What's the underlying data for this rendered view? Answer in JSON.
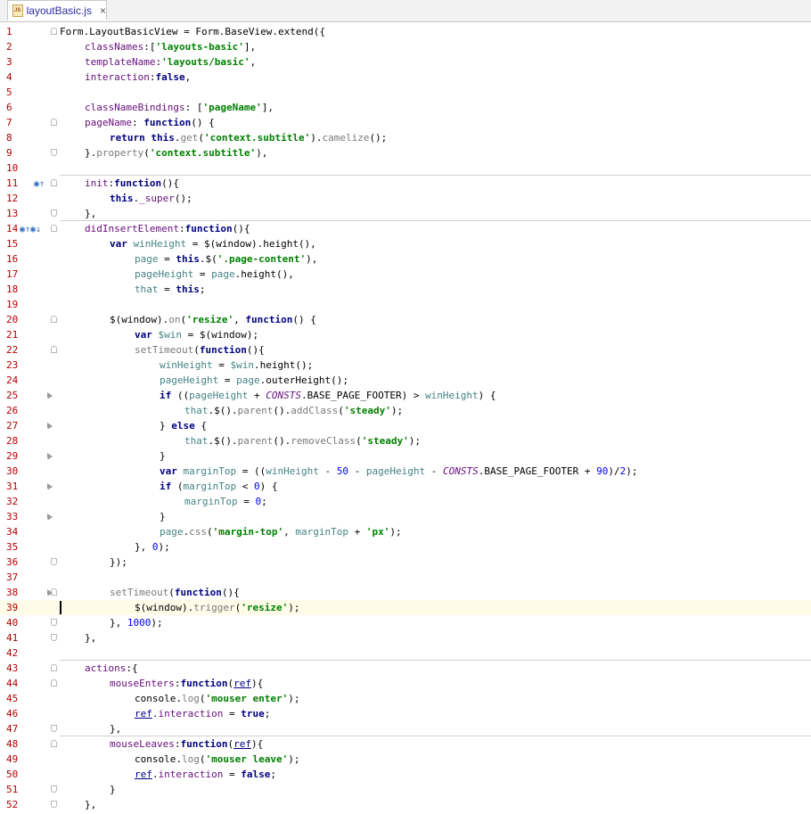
{
  "tab": {
    "title": "layoutBasic.js",
    "icon": "js-file-icon",
    "close": "×"
  },
  "lines": [
    {
      "n": "1",
      "indent": 0,
      "t": [
        [
          "pl",
          "Form.LayoutBasicView = Form.BaseView.extend({"
        ]
      ]
    },
    {
      "n": "2",
      "indent": 4,
      "t": [
        [
          "prop",
          "classNames"
        ],
        [
          "pl",
          ":["
        ],
        [
          "str",
          "'layouts-basic'"
        ],
        [
          "pl",
          "],"
        ]
      ]
    },
    {
      "n": "3",
      "indent": 4,
      "t": [
        [
          "prop",
          "templateName"
        ],
        [
          "pl",
          ":"
        ],
        [
          "str",
          "'layouts/basic'"
        ],
        [
          "pl",
          ","
        ]
      ]
    },
    {
      "n": "4",
      "indent": 4,
      "t": [
        [
          "prop",
          "interaction"
        ],
        [
          "pl",
          ":"
        ],
        [
          "kw",
          "false"
        ],
        [
          "pl",
          ","
        ]
      ]
    },
    {
      "n": "5",
      "indent": 0,
      "t": []
    },
    {
      "n": "6",
      "indent": 4,
      "t": [
        [
          "prop",
          "classNameBindings"
        ],
        [
          "pl",
          ": ["
        ],
        [
          "str",
          "'pageName'"
        ],
        [
          "pl",
          "],"
        ]
      ]
    },
    {
      "n": "7",
      "indent": 4,
      "t": [
        [
          "prop",
          "pageName"
        ],
        [
          "pl",
          ": "
        ],
        [
          "kw",
          "function"
        ],
        [
          "pl",
          "() {"
        ]
      ]
    },
    {
      "n": "8",
      "indent": 8,
      "t": [
        [
          "kw",
          "return this"
        ],
        [
          "pl",
          "."
        ],
        [
          "fn",
          "get"
        ],
        [
          "pl",
          "("
        ],
        [
          "str",
          "'context.subtitle'"
        ],
        [
          "pl",
          ")."
        ],
        [
          "fn",
          "camelize"
        ],
        [
          "pl",
          "();"
        ]
      ]
    },
    {
      "n": "9",
      "indent": 4,
      "t": [
        [
          "pl",
          "}."
        ],
        [
          "fn",
          "property"
        ],
        [
          "pl",
          "("
        ],
        [
          "str",
          "'context.subtitle'"
        ],
        [
          "pl",
          "),"
        ]
      ]
    },
    {
      "n": "10",
      "indent": 0,
      "t": []
    },
    {
      "n": "11",
      "indent": 4,
      "t": [
        [
          "prop",
          "init"
        ],
        [
          "pl",
          ":"
        ],
        [
          "kw",
          "function"
        ],
        [
          "pl",
          "(){"
        ]
      ]
    },
    {
      "n": "12",
      "indent": 8,
      "t": [
        [
          "kw",
          "this"
        ],
        [
          "pl",
          "."
        ],
        [
          "prop",
          "_super"
        ],
        [
          "pl",
          "();"
        ]
      ]
    },
    {
      "n": "13",
      "indent": 4,
      "t": [
        [
          "pl",
          "},"
        ]
      ]
    },
    {
      "n": "14",
      "indent": 4,
      "t": [
        [
          "prop",
          "didInsertElement"
        ],
        [
          "pl",
          ":"
        ],
        [
          "kw",
          "function"
        ],
        [
          "pl",
          "(){"
        ]
      ]
    },
    {
      "n": "15",
      "indent": 8,
      "t": [
        [
          "kw",
          "var "
        ],
        [
          "var",
          "winHeight"
        ],
        [
          "pl",
          " = $(window)."
        ],
        [
          "pl",
          "height(),"
        ]
      ]
    },
    {
      "n": "16",
      "indent": 12,
      "t": [
        [
          "var",
          "page"
        ],
        [
          "pl",
          " = "
        ],
        [
          "kw",
          "this"
        ],
        [
          "pl",
          ".$("
        ],
        [
          "str",
          "'.page-content'"
        ],
        [
          "pl",
          "),"
        ]
      ]
    },
    {
      "n": "17",
      "indent": 12,
      "t": [
        [
          "var",
          "pageHeight"
        ],
        [
          "pl",
          " = "
        ],
        [
          "var",
          "page"
        ],
        [
          "pl",
          ".height(),"
        ]
      ]
    },
    {
      "n": "18",
      "indent": 12,
      "t": [
        [
          "var",
          "that"
        ],
        [
          "pl",
          " = "
        ],
        [
          "kw",
          "this"
        ],
        [
          "pl",
          ";"
        ]
      ]
    },
    {
      "n": "19",
      "indent": 0,
      "t": []
    },
    {
      "n": "20",
      "indent": 8,
      "t": [
        [
          "pl",
          "$(window)."
        ],
        [
          "fn",
          "on"
        ],
        [
          "pl",
          "("
        ],
        [
          "str",
          "'resize'"
        ],
        [
          "pl",
          ", "
        ],
        [
          "kw",
          "function"
        ],
        [
          "pl",
          "() {"
        ]
      ]
    },
    {
      "n": "21",
      "indent": 12,
      "t": [
        [
          "kw",
          "var "
        ],
        [
          "var",
          "$win"
        ],
        [
          "pl",
          " = $(window);"
        ]
      ]
    },
    {
      "n": "22",
      "indent": 12,
      "t": [
        [
          "fn",
          "setTimeout"
        ],
        [
          "pl",
          "("
        ],
        [
          "kw",
          "function"
        ],
        [
          "pl",
          "(){"
        ]
      ]
    },
    {
      "n": "23",
      "indent": 16,
      "t": [
        [
          "var",
          "winHeight"
        ],
        [
          "pl",
          " = "
        ],
        [
          "var",
          "$win"
        ],
        [
          "pl",
          ".height();"
        ]
      ]
    },
    {
      "n": "24",
      "indent": 16,
      "t": [
        [
          "var",
          "pageHeight"
        ],
        [
          "pl",
          " = "
        ],
        [
          "var",
          "page"
        ],
        [
          "pl",
          ".outerHeight();"
        ]
      ]
    },
    {
      "n": "25",
      "indent": 16,
      "t": [
        [
          "kw",
          "if"
        ],
        [
          "pl",
          " (("
        ],
        [
          "var",
          "pageHeight"
        ],
        [
          "pl",
          " + "
        ],
        [
          "con",
          "CONSTS"
        ],
        [
          "pl",
          ".BASE_PAGE_FOOTER) > "
        ],
        [
          "var",
          "winHeight"
        ],
        [
          "pl",
          ") {"
        ]
      ]
    },
    {
      "n": "26",
      "indent": 20,
      "t": [
        [
          "var",
          "that"
        ],
        [
          "pl",
          ".$()."
        ],
        [
          "fn",
          "parent"
        ],
        [
          "pl",
          "()."
        ],
        [
          "fn",
          "addClass"
        ],
        [
          "pl",
          "("
        ],
        [
          "str",
          "'steady'"
        ],
        [
          "pl",
          ");"
        ]
      ]
    },
    {
      "n": "27",
      "indent": 16,
      "t": [
        [
          "pl",
          "} "
        ],
        [
          "kw",
          "else"
        ],
        [
          "pl",
          " {"
        ]
      ]
    },
    {
      "n": "28",
      "indent": 20,
      "t": [
        [
          "var",
          "that"
        ],
        [
          "pl",
          ".$()."
        ],
        [
          "fn",
          "parent"
        ],
        [
          "pl",
          "()."
        ],
        [
          "fn",
          "removeClass"
        ],
        [
          "pl",
          "("
        ],
        [
          "str",
          "'steady'"
        ],
        [
          "pl",
          ");"
        ]
      ]
    },
    {
      "n": "29",
      "indent": 16,
      "t": [
        [
          "pl",
          "}"
        ]
      ]
    },
    {
      "n": "30",
      "indent": 16,
      "t": [
        [
          "kw",
          "var "
        ],
        [
          "var",
          "marginTop"
        ],
        [
          "pl",
          " = (("
        ],
        [
          "var",
          "winHeight"
        ],
        [
          "pl",
          " - "
        ],
        [
          "num",
          "50"
        ],
        [
          "pl",
          " - "
        ],
        [
          "var",
          "pageHeight"
        ],
        [
          "pl",
          " - "
        ],
        [
          "con",
          "CONSTS"
        ],
        [
          "pl",
          ".BASE_PAGE_FOOTER + "
        ],
        [
          "num",
          "90"
        ],
        [
          "pl",
          ")/"
        ],
        [
          "num",
          "2"
        ],
        [
          "pl",
          ");"
        ]
      ]
    },
    {
      "n": "31",
      "indent": 16,
      "t": [
        [
          "kw",
          "if"
        ],
        [
          "pl",
          " ("
        ],
        [
          "var",
          "marginTop"
        ],
        [
          "pl",
          " < "
        ],
        [
          "num",
          "0"
        ],
        [
          "pl",
          ") {"
        ]
      ]
    },
    {
      "n": "32",
      "indent": 20,
      "t": [
        [
          "var",
          "marginTop"
        ],
        [
          "pl",
          " = "
        ],
        [
          "num",
          "0"
        ],
        [
          "pl",
          ";"
        ]
      ]
    },
    {
      "n": "33",
      "indent": 16,
      "t": [
        [
          "pl",
          "}"
        ]
      ]
    },
    {
      "n": "34",
      "indent": 16,
      "t": [
        [
          "var",
          "page"
        ],
        [
          "pl",
          "."
        ],
        [
          "fn",
          "css"
        ],
        [
          "pl",
          "("
        ],
        [
          "str",
          "'margin-top'"
        ],
        [
          "pl",
          ", "
        ],
        [
          "var",
          "marginTop"
        ],
        [
          "pl",
          " + "
        ],
        [
          "str",
          "'px'"
        ],
        [
          "pl",
          ");"
        ]
      ]
    },
    {
      "n": "35",
      "indent": 12,
      "t": [
        [
          "pl",
          "}, "
        ],
        [
          "num",
          "0"
        ],
        [
          "pl",
          ");"
        ]
      ]
    },
    {
      "n": "36",
      "indent": 8,
      "t": [
        [
          "pl",
          "});"
        ]
      ]
    },
    {
      "n": "37",
      "indent": 0,
      "t": []
    },
    {
      "n": "38",
      "indent": 8,
      "t": [
        [
          "fn",
          "setTimeout"
        ],
        [
          "pl",
          "("
        ],
        [
          "kw",
          "function"
        ],
        [
          "pl",
          "(){"
        ]
      ]
    },
    {
      "n": "39",
      "indent": 12,
      "t": [
        [
          "pl",
          "$(window)."
        ],
        [
          "fn",
          "trigger"
        ],
        [
          "pl",
          "("
        ],
        [
          "str",
          "'resize'"
        ],
        [
          "pl",
          ");"
        ]
      ]
    },
    {
      "n": "40",
      "indent": 8,
      "t": [
        [
          "pl",
          "}, "
        ],
        [
          "num",
          "1000"
        ],
        [
          "pl",
          ");"
        ]
      ]
    },
    {
      "n": "41",
      "indent": 4,
      "t": [
        [
          "pl",
          "},"
        ]
      ]
    },
    {
      "n": "42",
      "indent": 0,
      "t": []
    },
    {
      "n": "43",
      "indent": 4,
      "t": [
        [
          "prop",
          "actions"
        ],
        [
          "pl",
          ":{"
        ]
      ]
    },
    {
      "n": "44",
      "indent": 8,
      "t": [
        [
          "prop",
          "mouseEnters"
        ],
        [
          "pl",
          ":"
        ],
        [
          "kw",
          "function"
        ],
        [
          "pl",
          "("
        ],
        [
          "ul",
          "ref"
        ],
        [
          "pl",
          "){"
        ]
      ]
    },
    {
      "n": "45",
      "indent": 12,
      "t": [
        [
          "pl",
          "console."
        ],
        [
          "fn",
          "log"
        ],
        [
          "pl",
          "("
        ],
        [
          "str",
          "'mouser enter'"
        ],
        [
          "pl",
          ");"
        ]
      ]
    },
    {
      "n": "46",
      "indent": 12,
      "t": [
        [
          "ul",
          "ref"
        ],
        [
          "pl",
          "."
        ],
        [
          "prop",
          "interaction"
        ],
        [
          "pl",
          " = "
        ],
        [
          "kw",
          "true"
        ],
        [
          "pl",
          ";"
        ]
      ]
    },
    {
      "n": "47",
      "indent": 8,
      "t": [
        [
          "pl",
          "},"
        ]
      ]
    },
    {
      "n": "48",
      "indent": 8,
      "t": [
        [
          "prop",
          "mouseLeaves"
        ],
        [
          "pl",
          ":"
        ],
        [
          "kw",
          "function"
        ],
        [
          "pl",
          "("
        ],
        [
          "ul",
          "ref"
        ],
        [
          "pl",
          "){"
        ]
      ]
    },
    {
      "n": "49",
      "indent": 12,
      "t": [
        [
          "pl",
          "console."
        ],
        [
          "fn",
          "log"
        ],
        [
          "pl",
          "("
        ],
        [
          "str",
          "'mouser leave'"
        ],
        [
          "pl",
          ");"
        ]
      ]
    },
    {
      "n": "50",
      "indent": 12,
      "t": [
        [
          "ul",
          "ref"
        ],
        [
          "pl",
          "."
        ],
        [
          "prop",
          "interaction"
        ],
        [
          "pl",
          " = "
        ],
        [
          "kw",
          "false"
        ],
        [
          "pl",
          ";"
        ]
      ]
    },
    {
      "n": "51",
      "indent": 8,
      "t": [
        [
          "pl",
          "}"
        ]
      ]
    },
    {
      "n": "52",
      "indent": 4,
      "t": [
        [
          "pl",
          "},"
        ]
      ]
    }
  ],
  "gutter": {
    "open_folds": [
      "1",
      "7",
      "11",
      "14",
      "20",
      "22",
      "38",
      "43",
      "44",
      "48"
    ],
    "close_folds": [
      "9",
      "13",
      "36",
      "40",
      "41",
      "47",
      "51",
      "52"
    ],
    "mini_folds": [
      "25",
      "27",
      "29",
      "31",
      "33",
      "38"
    ],
    "override_icons": [
      "11",
      "14"
    ],
    "current_line": "39"
  },
  "separators_after": [
    "10",
    "13",
    "42",
    "47"
  ],
  "colors": {
    "line_number": "#b00000",
    "keyword": "#000080",
    "string": "#008000",
    "number": "#0000ff",
    "property": "#660e7a",
    "current_line_bg": "#fefbe8"
  }
}
